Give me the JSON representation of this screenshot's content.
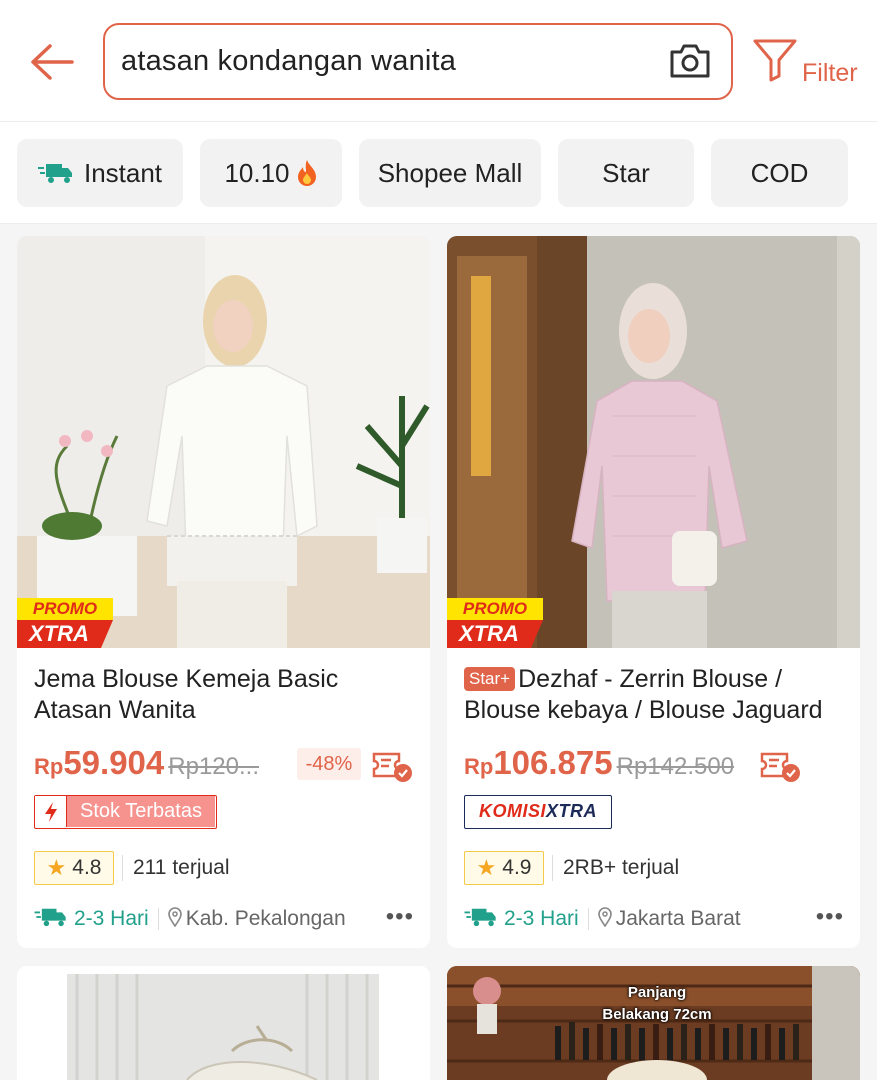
{
  "header": {
    "search_query": "atasan kondangan wanita",
    "filter_label": "Filter",
    "back_icon": "arrow-left-icon",
    "camera_icon": "camera-icon",
    "filter_icon": "funnel-icon"
  },
  "quick_filters": [
    {
      "label": "Instant",
      "icon": "delivery-truck-icon"
    },
    {
      "label": "10.10",
      "icon": "fire-icon"
    },
    {
      "label": "Shopee Mall"
    },
    {
      "label": "Star"
    },
    {
      "label": "COD"
    }
  ],
  "products": [
    {
      "promo_badge_top": "PROMO",
      "promo_badge_bottom": "XTRA",
      "title": "Jema Blouse Kemeja Basic Atasan Wanita",
      "currency": "Rp",
      "price": "59.904",
      "original_price": "Rp120...",
      "discount": "-48%",
      "stock_label": "Stok Terbatas",
      "rating": "4.8",
      "sold": "211 terjual",
      "shipping": "2-3 Hari",
      "location": "Kab. Pekalongan",
      "more": "•••"
    },
    {
      "promo_badge_top": "PROMO",
      "promo_badge_bottom": "XTRA",
      "star_badge": "Star+",
      "title": "Dezhaf - Zerrin Blouse / Blouse kebaya / Blouse Jaguard",
      "currency": "Rp",
      "price": "106.875",
      "original_price": "Rp142.500",
      "komisi_part1": "KOMISI",
      "komisi_part2": "XTRA",
      "rating": "4.9",
      "sold": "2RB+ terjual",
      "shipping": "2-3 Hari",
      "location": "Jakarta Barat",
      "more": "•••"
    },
    {
      "image": "product-photo"
    },
    {
      "overlay_line1": "Panjang",
      "overlay_line2": "Belakang 72cm"
    }
  ],
  "colors": {
    "accent": "#e0644a",
    "promo_red": "#e02b1a",
    "promo_yellow": "#ffe400",
    "ship_green": "#21a08b"
  }
}
